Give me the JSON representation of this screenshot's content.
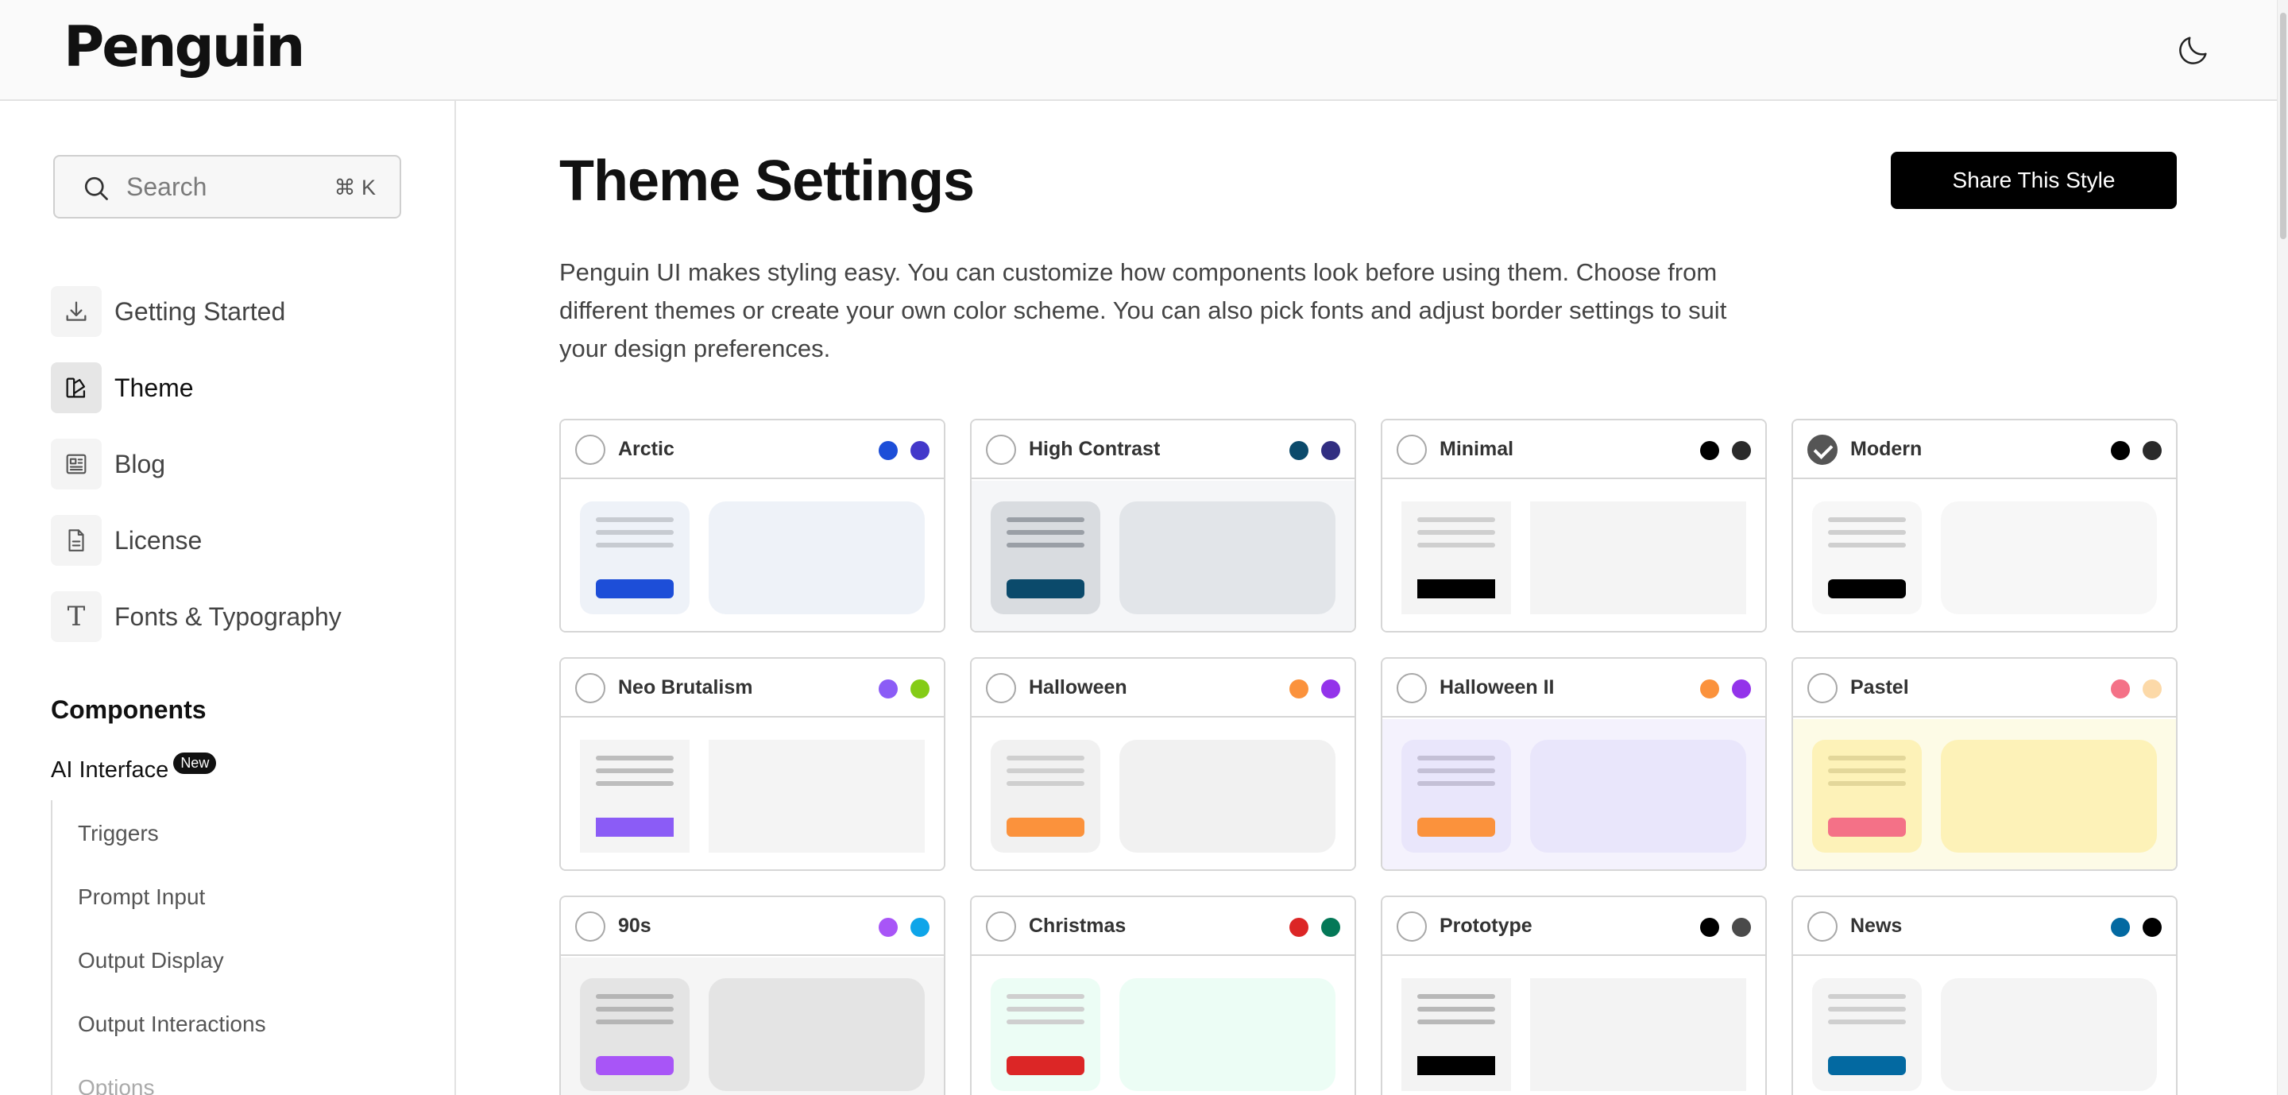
{
  "app": {
    "logo": "Penguin",
    "theme_toggle_icon": "moon-icon"
  },
  "search": {
    "placeholder": "Search",
    "shortcut": "⌘ K"
  },
  "sidebar": {
    "items": [
      {
        "label": "Getting Started",
        "icon": "download-icon",
        "active": false
      },
      {
        "label": "Theme",
        "icon": "palette-icon",
        "active": true
      },
      {
        "label": "Blog",
        "icon": "newspaper-icon",
        "active": false
      },
      {
        "label": "License",
        "icon": "document-icon",
        "active": false
      },
      {
        "label": "Fonts & Typography",
        "icon": "typography-icon",
        "glyph": "T",
        "active": false
      }
    ],
    "section_title": "Components",
    "group": {
      "title": "AI Interface",
      "badge": "New"
    },
    "subitems": [
      "Triggers",
      "Prompt Input",
      "Output Display",
      "Output Interactions",
      "Options"
    ]
  },
  "main": {
    "title": "Theme Settings",
    "share_label": "Share This Style",
    "description": "Penguin UI makes styling easy. You can customize how components look before using them. Choose from different themes or create your own color scheme. You can also pick fonts and adjust border settings to suit your design preferences."
  },
  "themes": [
    {
      "name": "Arctic",
      "selected": false,
      "colors": [
        "#1d4ed8",
        "#4338ca"
      ],
      "body_bg": "#ffffff",
      "mini_bg": "#eef2f8",
      "big_bg": "#eef2f8",
      "line": "#c7cbd1",
      "btn": "#1d4ed8",
      "rounded": true
    },
    {
      "name": "High Contrast",
      "selected": false,
      "colors": [
        "#0b4a6b",
        "#312e81"
      ],
      "body_bg": "#f5f6f8",
      "mini_bg": "#d9dce0",
      "big_bg": "#e2e5e9",
      "line": "#9a9fa6",
      "btn": "#0b4a6b",
      "rounded": true
    },
    {
      "name": "Minimal",
      "selected": false,
      "colors": [
        "#000000",
        "#2a2a2a"
      ],
      "body_bg": "#ffffff",
      "mini_bg": "#f4f4f4",
      "big_bg": "#f4f4f4",
      "line": "#cfcfcf",
      "btn": "#000000",
      "rounded": false
    },
    {
      "name": "Modern",
      "selected": true,
      "colors": [
        "#000000",
        "#2a2a2a"
      ],
      "body_bg": "#ffffff",
      "mini_bg": "#f7f7f7",
      "big_bg": "#f7f7f7",
      "line": "#cfcfcf",
      "btn": "#000000",
      "rounded": true
    },
    {
      "name": "Neo Brutalism",
      "selected": false,
      "colors": [
        "#8b5cf6",
        "#84cc16"
      ],
      "body_bg": "#ffffff",
      "mini_bg": "#f4f4f4",
      "big_bg": "#f4f4f4",
      "line": "#bdbdbd",
      "btn": "#8b5cf6",
      "rounded": false
    },
    {
      "name": "Halloween",
      "selected": false,
      "colors": [
        "#fb923c",
        "#9333ea"
      ],
      "body_bg": "#ffffff",
      "mini_bg": "#f1f1f1",
      "big_bg": "#f1f1f1",
      "line": "#cfcfcf",
      "btn": "#fb923c",
      "rounded": true
    },
    {
      "name": "Halloween II",
      "selected": false,
      "colors": [
        "#fb923c",
        "#9333ea"
      ],
      "body_bg": "#f4f2fd",
      "mini_bg": "#e9e6fb",
      "big_bg": "#e9e6fb",
      "line": "#c4c0d6",
      "btn": "#fb923c",
      "rounded": true
    },
    {
      "name": "Pastel",
      "selected": false,
      "colors": [
        "#f47187",
        "#fcd9a8"
      ],
      "body_bg": "#fdfbe6",
      "mini_bg": "#fdf2b8",
      "big_bg": "#fdf2b8",
      "line": "#e3d79a",
      "btn": "#f47187",
      "rounded": true
    },
    {
      "name": "90s",
      "selected": false,
      "colors": [
        "#a855f7",
        "#0ea5e9"
      ],
      "body_bg": "#f5f5f5",
      "mini_bg": "#e4e4e4",
      "big_bg": "#e4e4e4",
      "line": "#b5b5b5",
      "btn": "#a855f7",
      "rounded": true
    },
    {
      "name": "Christmas",
      "selected": false,
      "colors": [
        "#dc2626",
        "#047857"
      ],
      "body_bg": "#ffffff",
      "mini_bg": "#ecfdf5",
      "big_bg": "#ecfdf5",
      "line": "#cfcfcf",
      "btn": "#dc2626",
      "rounded": true
    },
    {
      "name": "Prototype",
      "selected": false,
      "colors": [
        "#000000",
        "#4a4a4a"
      ],
      "body_bg": "#ffffff",
      "mini_bg": "#f3f3f3",
      "big_bg": "#f3f3f3",
      "line": "#b8b8b8",
      "btn": "#000000",
      "rounded": false
    },
    {
      "name": "News",
      "selected": false,
      "colors": [
        "#0369a1",
        "#000000"
      ],
      "body_bg": "#ffffff",
      "mini_bg": "#f4f4f4",
      "big_bg": "#f4f4f4",
      "line": "#cfcfcf",
      "btn": "#0369a1",
      "rounded": true
    }
  ]
}
